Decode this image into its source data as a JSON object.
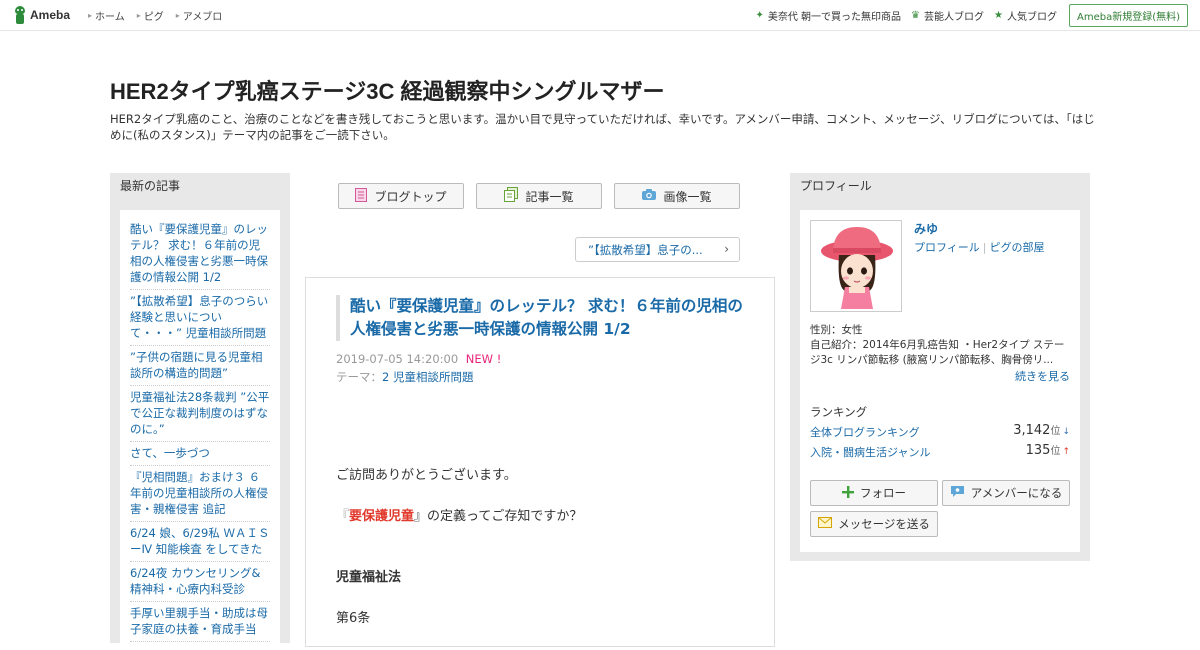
{
  "topbar": {
    "logo_text": "Ameba",
    "nav": [
      "ホーム",
      "ピグ",
      "アメブロ"
    ],
    "right_links": [
      {
        "icon": "sparkle-icon",
        "label": "美奈代 朝一で買った無印商品"
      },
      {
        "icon": "crown-icon",
        "label": "芸能人ブログ"
      },
      {
        "icon": "star-icon",
        "label": "人気ブログ"
      }
    ],
    "register_label": "Ameba新規登録(無料)"
  },
  "header": {
    "title": "HER2タイプ乳癌ステージ3C 経過観察中シングルマザー",
    "description": "HER2タイプ乳癌のこと、治療のことなどを書き残しておこうと思います。温かい目で見守っていただければ、幸いです。アメンバー申請、コメント、メッセージ、リブログについては、「はじめに(私のスタンス)」テーマ内の記事をご一読下さい。"
  },
  "left": {
    "heading": "最新の記事",
    "items": [
      "酷い『要保護児童』のレッテル？ 求む！６年前の児相の人権侵害と劣悪一時保護の情報公開 1/2",
      "”【拡散希望】息子のつらい経験と思いについて・・・” 児童相談所問題",
      "”子供の宿題に見る児童相談所の構造的問題”",
      "児童福祉法28条裁判 ”公平で公正な裁判制度のはずなのに。”",
      "さて、一歩づつ",
      "『児相問題』おまけ３ ６年前の児童相談所の人権侵害・親権侵害 追記",
      "6/24 娘、6/29私 ＷＡＩＳーⅣ 知能検査 をしてきた",
      "6/24夜 カウンセリング&精神科・心療内科受診",
      "手厚い里親手当・助成は母子家庭の扶養・育成手当"
    ]
  },
  "center": {
    "buttons": [
      {
        "icon": "document-icon",
        "label": "ブログトップ"
      },
      {
        "icon": "list-icon",
        "label": "記事一覧"
      },
      {
        "icon": "camera-icon",
        "label": "画像一覧"
      }
    ],
    "prev_link": "”【拡散希望】息子の...",
    "article": {
      "title": "酷い『要保護児童』のレッテル？ 求む！６年前の児相の人権侵害と劣悪一時保護の情報公開 1/2",
      "date": "2019-07-05 14:20:00",
      "new_badge": "NEW !",
      "theme_label": "テーマ：",
      "theme": "2 児童相談所問題",
      "body": {
        "greeting": "ご訪問ありがとうございます。",
        "q_open": "『",
        "q_strong": "要保護児童",
        "q_rest": "』の定義ってご存知ですか？",
        "section": "児童福祉法",
        "article_no": "第6条"
      }
    }
  },
  "right": {
    "heading": "プロフィール",
    "name": "みゆ",
    "links": [
      "プロフィール",
      "ピグの部屋"
    ],
    "gender": "性別：女性",
    "intro": "自己紹介：2014年6月乳癌告知 ・Her2タイプ ステージ3c リンパ節転移 (腋窩リンパ節転移、胸骨傍リ...",
    "more": "続きを見る",
    "ranking_heading": "ランキング",
    "rankings": [
      {
        "label": "全体ブログランキング",
        "value": "3,142",
        "unit": "位",
        "trend": "↓"
      },
      {
        "label": "入院・闘病生活ジャンル",
        "value": "135",
        "unit": "位",
        "trend": "↑"
      }
    ],
    "follow": "フォロー",
    "amember": "アメンバーになる",
    "message": "メッセージを送る"
  }
}
